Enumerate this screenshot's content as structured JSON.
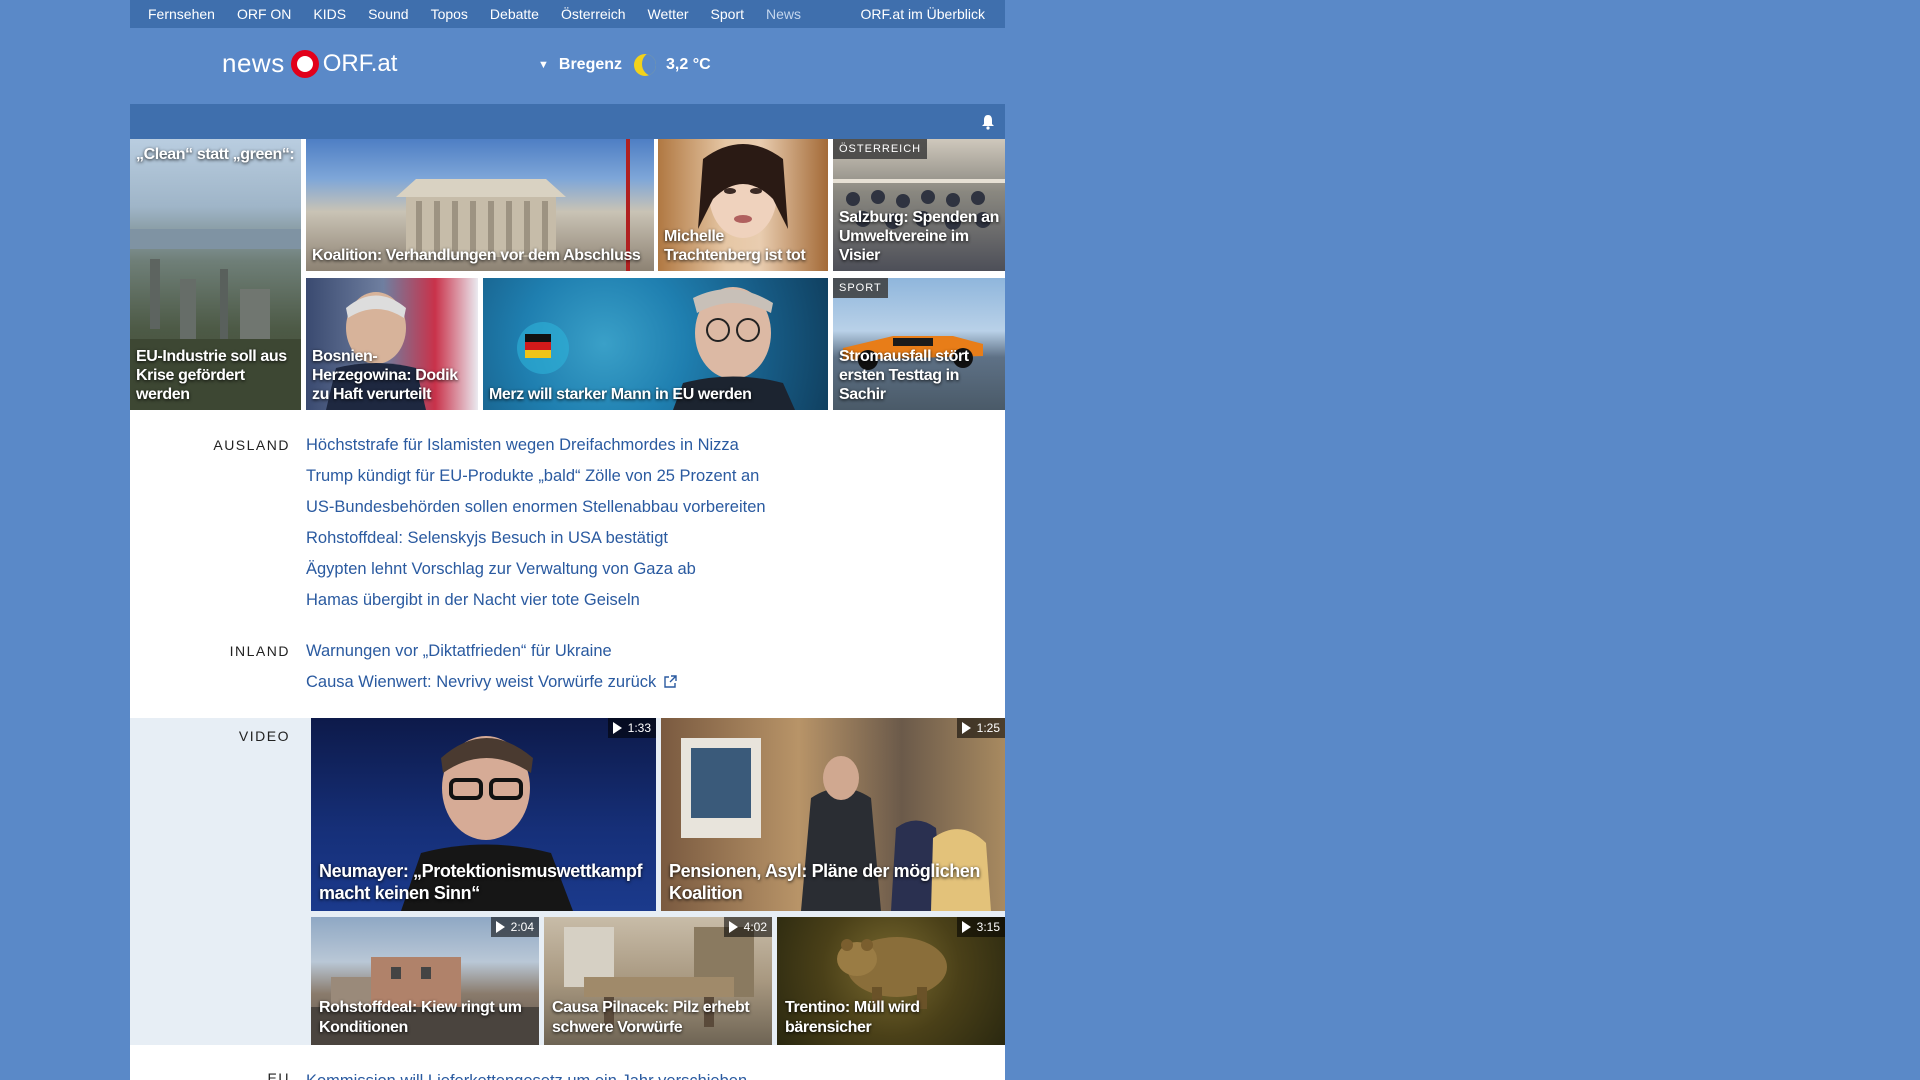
{
  "nav": {
    "items": [
      "Fernsehen",
      "ORF ON",
      "KIDS",
      "Sound",
      "Topos",
      "Debatte",
      "Österreich",
      "Wetter",
      "Sport",
      "News"
    ],
    "right": "ORF.at im Überblick"
  },
  "header": {
    "logo_news": "news",
    "logo_orf": "ORF.at",
    "location": "Bregenz",
    "temperature": "3,2 °C"
  },
  "tiles": [
    {
      "caption": "„Clean“ statt „green“:",
      "tag": ""
    },
    {
      "caption": "EU-Industrie soll aus Krise gefördert werden",
      "tag": ""
    },
    {
      "caption": "Koalition: Verhandlungen vor dem Abschluss",
      "tag": ""
    },
    {
      "caption": "Michelle Trachtenberg ist tot",
      "tag": ""
    },
    {
      "caption": "Salzburg: Spenden an Umweltvereine im Visier",
      "tag": "ÖSTERREICH"
    },
    {
      "caption": "Bosnien-Herzegowina: Dodik zu Haft verurteilt",
      "tag": ""
    },
    {
      "caption": "Merz will starker Mann in EU werden",
      "tag": ""
    },
    {
      "caption": "Stromausfall stört ersten Testtag in Sachir",
      "tag": "SPORT"
    }
  ],
  "sections": {
    "ausland": {
      "label": "AUSLAND",
      "links": [
        "Höchststrafe für Islamisten wegen Dreifachmordes in Nizza",
        "Trump kündigt für EU-Produkte „bald“ Zölle von 25 Prozent an",
        "US-Bundesbehörden sollen enormen Stellenabbau vorbereiten",
        "Rohstoffdeal: Selenskyjs Besuch in USA bestätigt",
        "Ägypten lehnt Vorschlag zur Verwaltung von Gaza ab",
        "Hamas übergibt in der Nacht vier tote Geiseln"
      ]
    },
    "inland": {
      "label": "INLAND",
      "links": [
        "Warnungen vor „Diktatfrieden“ für Ukraine",
        "Causa Wienwert: Nevrivy weist Vorwürfe zurück"
      ]
    },
    "video": {
      "label": "VIDEO",
      "items": [
        {
          "caption": "Neumayer: „Protektionismuswettkampf macht keinen Sinn“",
          "duration": "1:33"
        },
        {
          "caption": "Pensionen, Asyl: Pläne der möglichen Koalition",
          "duration": "1:25"
        },
        {
          "caption": "Rohstoffdeal: Kiew ringt um Konditionen",
          "duration": "2:04"
        },
        {
          "caption": "Causa Pilnacek: Pilz erhebt schwere Vorwürfe",
          "duration": "4:02"
        },
        {
          "caption": "Trentino: Müll wird bärensicher",
          "duration": "3:15"
        }
      ]
    },
    "eu": {
      "label": "EU",
      "links": [
        "Kommission will Lieferkettengesetz um ein Jahr verschieben"
      ]
    }
  },
  "colors": {
    "background": "#5a89c8",
    "nav_bar": "#3f6fad",
    "link": "#2a5aa0",
    "video_bg": "#e7eef5",
    "orf_red": "#e2001a"
  }
}
